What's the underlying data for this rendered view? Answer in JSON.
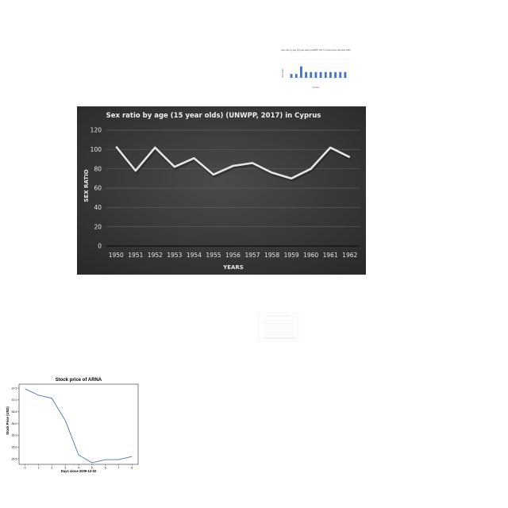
{
  "chart_data": [
    {
      "type": "bar",
      "title": "Sex ratio by age (15 year olds) (UNWPP, 2017) in Dominican Republic 1950",
      "xlabel": "Country",
      "ylabel": "Sex Ratio",
      "categories": [
        "",
        "",
        "",
        "",
        "",
        "",
        "",
        "",
        "",
        "",
        "",
        ""
      ],
      "values": [
        4,
        4,
        12,
        6,
        6,
        6,
        6,
        6,
        6,
        6,
        6,
        6
      ],
      "ylim": [
        0,
        20
      ],
      "colors": {
        "bar": "#4472c4"
      }
    },
    {
      "type": "line",
      "title": "Sex ratio by age (15 year olds) (UNWPP, 2017) in Cyprus",
      "xlabel": "YEARS",
      "ylabel": "SEX RATIO",
      "x": [
        "1950",
        "1951",
        "1952",
        "1953",
        "1954",
        "1955",
        "1956",
        "1957",
        "1958",
        "1959",
        "1960",
        "1961",
        "1962"
      ],
      "values": [
        103,
        78,
        102,
        82,
        91,
        74,
        83,
        86,
        76,
        70,
        80,
        102,
        92
      ],
      "ylim": [
        0,
        120
      ],
      "yticks": [
        "0",
        "20",
        "40",
        "60",
        "80",
        "100",
        "120"
      ],
      "grid": true,
      "colors": {
        "background": "#3a3a3a",
        "line": "#e6e6e6"
      }
    },
    {
      "type": "line",
      "title": "",
      "xlabel": "",
      "ylabel": "",
      "x": [],
      "values": [],
      "grid": true
    },
    {
      "type": "line",
      "title": "Stock price of ARNA",
      "xlabel": "Days since 2009-12-02",
      "ylabel": "Stock Price (USD)",
      "x": [
        0,
        1,
        2,
        3,
        4,
        5,
        6,
        7,
        8
      ],
      "values": [
        37.7,
        37.5,
        37.4,
        36.7,
        35.6,
        35.35,
        35.45,
        35.45,
        35.55
      ],
      "xticks": [
        "0",
        "1",
        "2",
        "3",
        "4",
        "5",
        "6",
        "7",
        "8"
      ],
      "yticks": [
        "35.5",
        "36.0",
        "36.5",
        "36.0",
        "36.5",
        "37.0",
        "37.5"
      ],
      "ylim": [
        35.3,
        37.85
      ],
      "colors": {
        "line": "#4c72b0"
      }
    }
  ]
}
